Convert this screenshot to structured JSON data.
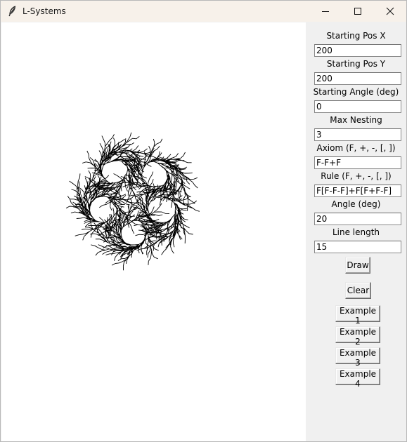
{
  "window": {
    "title": "L-Systems",
    "title_icon": "feather-icon",
    "controls": [
      "minimize-icon",
      "maximize-icon",
      "close-icon"
    ]
  },
  "canvas": {
    "background": "#ffffff",
    "stroke_color": "#000000"
  },
  "panel": {
    "fields": [
      {
        "label": "Starting Pos X",
        "value": "200"
      },
      {
        "label": "Starting Pos Y",
        "value": "200"
      },
      {
        "label": "Starting Angle (deg)",
        "value": "0"
      },
      {
        "label": "Max Nesting",
        "value": "3"
      },
      {
        "label": "Axiom (F, +, -, [, ])",
        "value": "F-F+F"
      },
      {
        "label": "Rule (F, +, -, [, ])",
        "value": "F[F-F-F]+F[F+F-F]"
      },
      {
        "label": "Angle (deg)",
        "value": "20"
      },
      {
        "label": "Line length",
        "value": "15"
      }
    ],
    "draw_label": "Draw",
    "clear_label": "Clear",
    "examples": [
      "Example 1",
      "Example 2",
      "Example 3",
      "Example 4"
    ]
  }
}
